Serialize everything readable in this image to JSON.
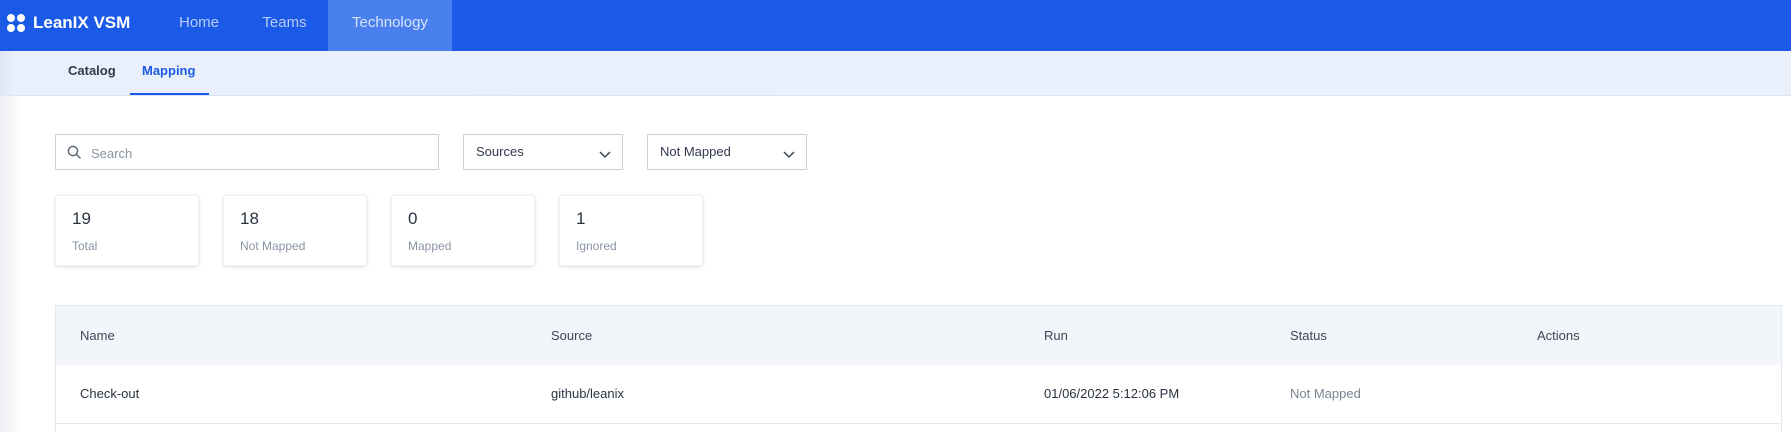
{
  "app": {
    "title": "LeanIX VSM"
  },
  "nav": {
    "items": [
      "Home",
      "Teams",
      "Technology"
    ],
    "active": "Technology"
  },
  "subnav": {
    "tabs": [
      "Catalog",
      "Mapping"
    ],
    "active": "Mapping"
  },
  "filters": {
    "search_placeholder": "Search",
    "sources_value": "Sources",
    "status_value": "Not Mapped"
  },
  "stats": [
    {
      "value": "19",
      "label": "Total"
    },
    {
      "value": "18",
      "label": "Not Mapped"
    },
    {
      "value": "0",
      "label": "Mapped"
    },
    {
      "value": "1",
      "label": "Ignored"
    }
  ],
  "table": {
    "columns": [
      "Name",
      "Source",
      "Run",
      "Status",
      "Actions"
    ],
    "rows": [
      {
        "name": "Check-out",
        "source": "github/leanix",
        "run": "01/06/2022 5:12:06 PM",
        "status": "Not Mapped",
        "actions": ""
      }
    ]
  },
  "colors": {
    "brand": "#1a5ae6",
    "nav_active": "#4a80ee",
    "subbar": "#eaf1fd"
  },
  "icons": {
    "logo": "dots-logo-icon",
    "search": "search-icon",
    "dropdown": "chevron-down-icon"
  }
}
